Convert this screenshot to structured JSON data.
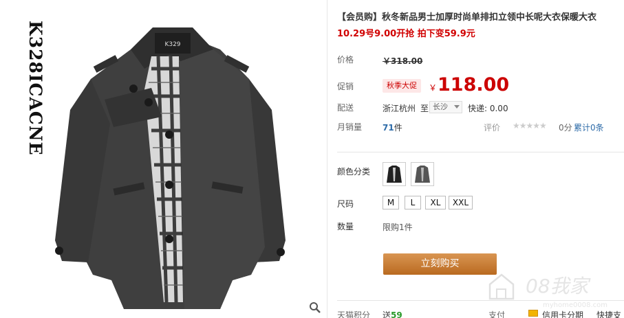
{
  "product": {
    "vertical_brand": "K328ICACNE",
    "title": "【会员购】秋冬新品男士加厚时尚单排扣立领中长呢大衣保暖大衣",
    "promo_line": "10.29号9.00开抢 拍下变59.9元",
    "price_label": "价格",
    "original_price": "￥318.00",
    "promo_label": "促销",
    "promo_badge": "秋季大促",
    "promo_currency": "￥",
    "promo_price": "118.00",
    "shipping_label": "配送",
    "ship_from": "浙江杭州",
    "ship_to_label": "至",
    "ship_to_value": "长沙",
    "shipping_fee": "快递: 0.00",
    "sales_label": "月销量",
    "sales_count": "71",
    "sales_unit": "件",
    "rating_label": "评价",
    "stars": "★★★★★",
    "score": "0分",
    "reviews": "累计0条",
    "color_label": "颜色分类",
    "size_label": "尺码",
    "sizes": [
      "M",
      "L",
      "XL",
      "XXL"
    ],
    "qty_label": "数量",
    "qty_note": "限购1件",
    "buy_button": "立刻购买",
    "points_label": "天猫积分",
    "points_prefix": "送",
    "points_value": "59",
    "payment_label": "支付",
    "card_payment": "信用卡分期",
    "fast_pay": "快捷支付"
  },
  "watermark": {
    "text": "08我家",
    "sub": "myhome0008.com"
  },
  "colors": {
    "accent_red": "#d10000",
    "link_blue": "#2d6ba8",
    "buy_button": "#c97a31"
  }
}
